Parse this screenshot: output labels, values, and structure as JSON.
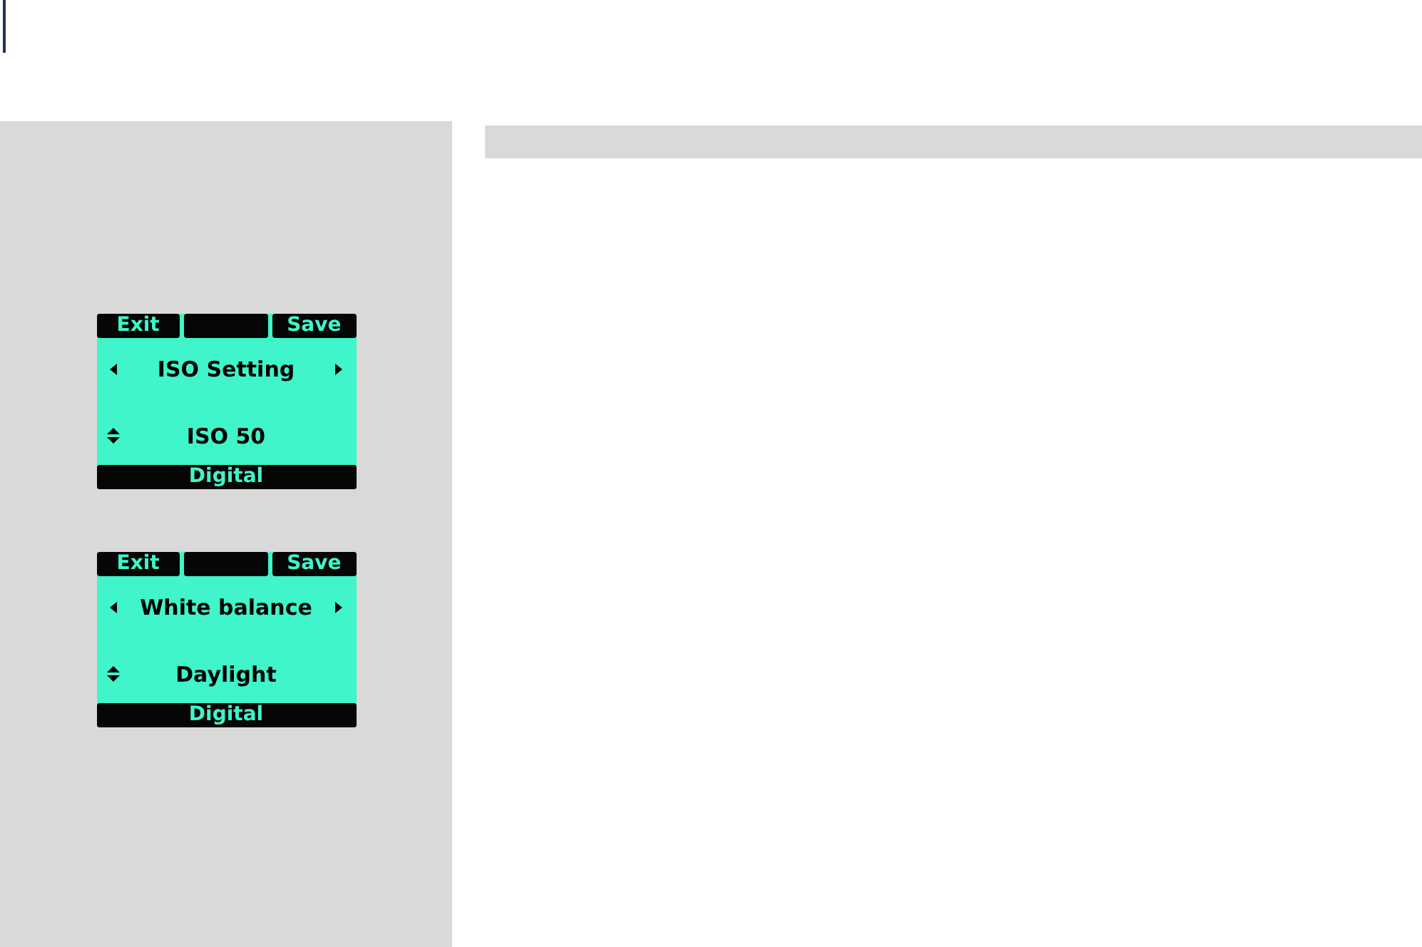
{
  "screens": [
    {
      "left_key": "Exit",
      "right_key": "Save",
      "setting": "ISO Setting",
      "value": "ISO 50",
      "mode": "Digital"
    },
    {
      "left_key": "Exit",
      "right_key": "Save",
      "setting": "White balance",
      "value": "Daylight",
      "mode": "Digital"
    }
  ]
}
